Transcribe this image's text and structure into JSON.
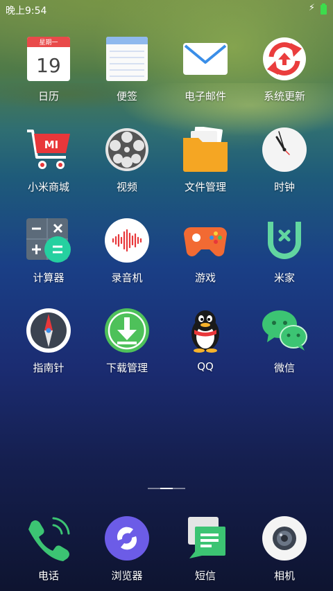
{
  "status": {
    "time": "晚上9:54",
    "charging_icon": "lightning-icon",
    "battery_icon": "battery-icon"
  },
  "apps": {
    "calendar": {
      "label": "日历",
      "weekday": "星期一",
      "day": "19"
    },
    "notes": {
      "label": "便签"
    },
    "email": {
      "label": "电子邮件"
    },
    "updater": {
      "label": "系统更新"
    },
    "mistore": {
      "label": "小米商城",
      "logo": "MI"
    },
    "video": {
      "label": "视频"
    },
    "files": {
      "label": "文件管理"
    },
    "clock": {
      "label": "时钟"
    },
    "calculator": {
      "label": "计算器"
    },
    "recorder": {
      "label": "录音机"
    },
    "games": {
      "label": "游戏"
    },
    "mihome": {
      "label": "米家"
    },
    "compass": {
      "label": "指南针"
    },
    "downloads": {
      "label": "下载管理"
    },
    "qq": {
      "label": "QQ"
    },
    "wechat": {
      "label": "微信"
    }
  },
  "dock": {
    "phone": {
      "label": "电话"
    },
    "browser": {
      "label": "浏览器"
    },
    "messages": {
      "label": "短信"
    },
    "camera": {
      "label": "相机"
    }
  }
}
